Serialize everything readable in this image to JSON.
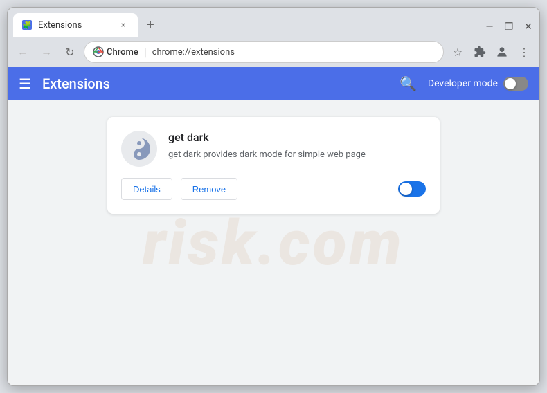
{
  "browser": {
    "tab": {
      "favicon_alt": "puzzle-piece",
      "label": "Extensions",
      "close_label": "×"
    },
    "new_tab_label": "+",
    "window_controls": {
      "minimize": "—",
      "maximize": "❐",
      "close": "✕"
    },
    "toolbar": {
      "back_label": "←",
      "forward_label": "→",
      "reload_label": "↻",
      "chrome_label": "Chrome",
      "address": "chrome://extensions",
      "bookmark_label": "☆",
      "extensions_label": "🧩",
      "profile_label": "👤",
      "menu_label": "⋮"
    }
  },
  "extensions_page": {
    "header": {
      "menu_label": "☰",
      "title": "Extensions",
      "search_label": "🔍",
      "dev_mode_label": "Developer mode",
      "dev_mode_on": false
    },
    "extension_card": {
      "name": "get dark",
      "description": "get dark provides dark mode for simple web page",
      "details_btn": "Details",
      "remove_btn": "Remove",
      "enabled": true
    }
  },
  "watermark": {
    "text": "risk.com"
  }
}
